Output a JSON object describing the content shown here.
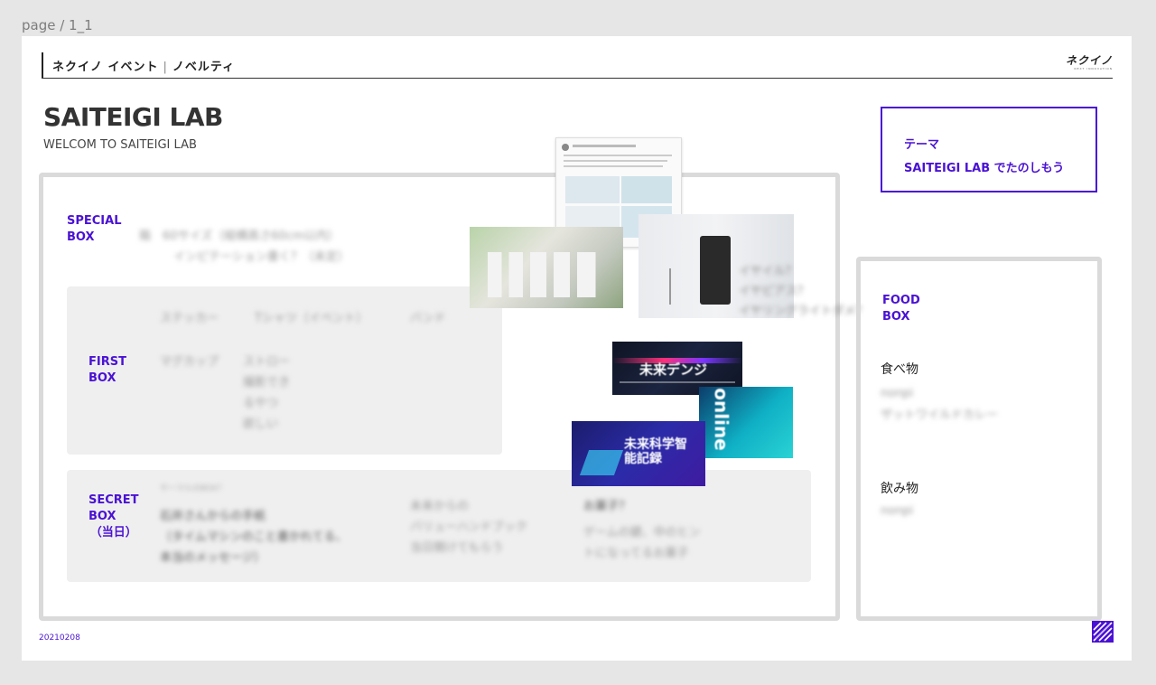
{
  "breadcrumb": "page / 1_1",
  "header": {
    "title_left": "ネクイノ イベント",
    "separator": "|",
    "title_right": "ノベルティ",
    "logo": "ネクイノ",
    "logo_sub": "NEXT INNOVATION"
  },
  "main": {
    "title": "SAITEIGI LAB",
    "subtitle": "WELCOM TO SAITEIGI LAB"
  },
  "theme": {
    "label": "テーマ",
    "text": "SAITEIGI LAB でたのしもう"
  },
  "special_box": {
    "label_line1": "SPECIAL",
    "label_line2": "BOX",
    "line1": "箱　60サイズ（縦横高さ60cm以内）",
    "line2": "インピテーション書く？（未定）"
  },
  "first_box": {
    "label_line1": "FIRST",
    "label_line2": "BOX",
    "items_row1": [
      "ステッカー",
      "Tシャツ（イベント）",
      "バンド"
    ],
    "item_mug": "マグカップ",
    "straw_lines": [
      "ストロー",
      "撮影でき",
      "るやつ",
      "欲しい"
    ]
  },
  "secret_box": {
    "label_line1": "SECRET",
    "label_line2": "BOX",
    "label_line3": "（当日）",
    "note": "サーマルのBOX？",
    "col1": [
      "石井さんからの手紙",
      "（タイムマシンのこと書かれてる、",
      "本当のメッセージ）"
    ],
    "col2": [
      "未来からの",
      "バリューハンドブック",
      "当日開けてもらう"
    ],
    "col3_title": "お菓子？",
    "col3": [
      "ゲームの鍵、中のヒン",
      "トになってるお菓子"
    ]
  },
  "photo_caption_lines": [
    "イヤイル？",
    "イヤピアス？",
    "イヤリングライトダメ？"
  ],
  "flyers": {
    "flyer1": "未来デンジ",
    "flyer2": "未来科学智能記録",
    "flyer3": "online"
  },
  "food": {
    "label_line1": "FOOD",
    "label_line2": "BOX",
    "food_heading": "食べ物",
    "food_items": [
      "nonpi",
      "ザットワイルドカレー"
    ],
    "drink_heading": "飲み物",
    "drink_items": [
      "nonpi"
    ]
  },
  "date": "20210208",
  "colors": {
    "accent": "#4a12d4",
    "panel": "#efefef",
    "border": "#dadada"
  }
}
